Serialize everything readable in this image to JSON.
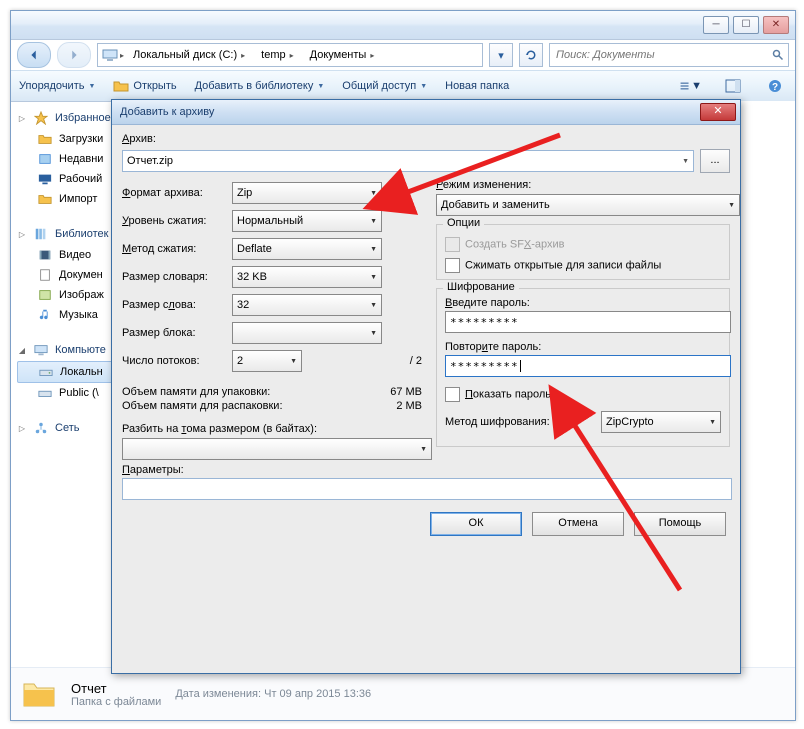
{
  "explorer": {
    "breadcrumb": {
      "icon": "computer-icon",
      "items": [
        "Локальный диск (C:)",
        "temp",
        "Документы"
      ]
    },
    "search_placeholder": "Поиск: Документы",
    "toolbar": {
      "organize": "Упорядочить",
      "open": "Открыть",
      "addlib": "Добавить в библиотеку",
      "share": "Общий доступ",
      "newfolder": "Новая папка"
    },
    "sidebar": {
      "favorites": {
        "head": "Избранное",
        "items": [
          "Загрузки",
          "Недавни",
          "Рабочий",
          "Импорт"
        ]
      },
      "libraries": {
        "head": "Библиотек",
        "items": [
          "Видео",
          "Докумен",
          "Изображ",
          "Музыка"
        ]
      },
      "computer": {
        "head": "Компьюте",
        "items": [
          "Локальн",
          "Public (\\"
        ]
      },
      "network": {
        "head": "Сеть"
      }
    },
    "details": {
      "name": "Отчет",
      "type": "Папка с файлами",
      "mod_label": "Дата изменения:",
      "mod_value": "Чт 09 апр 2015 13:36"
    }
  },
  "dialog": {
    "title": "Добавить к архиву",
    "archive_label": "Архив:",
    "archive_value": "Отчет.zip",
    "left": {
      "format_label": "Формат архива:",
      "format_value": "Zip",
      "level_label": "Уровень сжатия:",
      "level_value": "Нормальный",
      "method_label": "Метод сжатия:",
      "method_value": "Deflate",
      "dict_label": "Размер словаря:",
      "dict_value": "32 KB",
      "word_label": "Размер слова:",
      "word_value": "32",
      "block_label": "Размер блока:",
      "block_value": "",
      "threads_label": "Число потоков:",
      "threads_value": "2",
      "threads_max": "/ 2",
      "mem_pack_label": "Объем памяти для упаковки:",
      "mem_pack_value": "67 MB",
      "mem_unpack_label": "Объем памяти для распаковки:",
      "mem_unpack_value": "2 MB",
      "split_label": "Разбить на тома размером (в байтах):",
      "params_label": "Параметры:"
    },
    "right": {
      "mode_label": "Режим изменения:",
      "mode_value": "Добавить и заменить",
      "options_group": "Опции",
      "opt_sfx": "Создать SFX-архив",
      "opt_open": "Сжимать открытые для записи файлы",
      "enc_group": "Шифрование",
      "enc_enter": "Введите пароль:",
      "enc_repeat": "Повторите пароль:",
      "enc_pwd1": "*********",
      "enc_pwd2": "*********",
      "enc_show": "Показать пароль",
      "enc_method_label": "Метод шифрования:",
      "enc_method_value": "ZipCrypto"
    },
    "buttons": {
      "ok": "ОК",
      "cancel": "Отмена",
      "help": "Помощь"
    }
  }
}
